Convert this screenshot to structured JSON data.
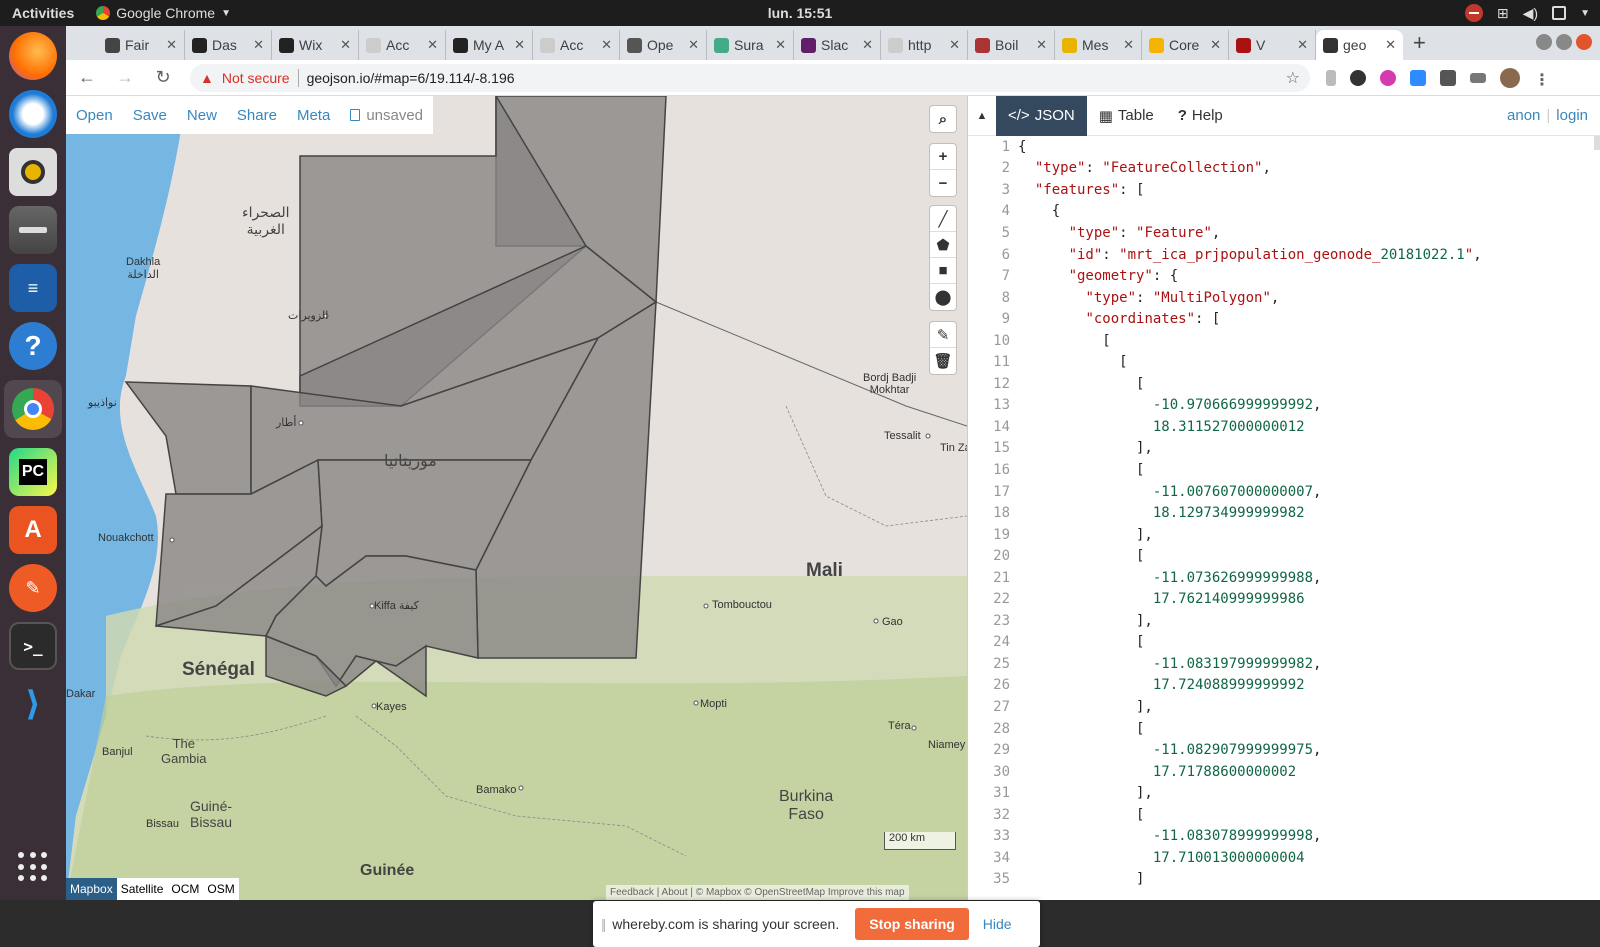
{
  "topbar": {
    "activities": "Activities",
    "app_name": "Google Chrome",
    "clock": "lun. 15:51"
  },
  "dock": {
    "apps": [
      "Firefox",
      "Thunderbird",
      "Rhythmbox",
      "Files",
      "LibreOffice Writer",
      "Help",
      "Google Chrome",
      "PyCharm",
      "Ubuntu Software",
      "Postman",
      "Terminal",
      "Visual Studio Code"
    ]
  },
  "browser": {
    "tabs": [
      {
        "label": "Fair",
        "color": "#444"
      },
      {
        "label": "Das",
        "color": "#222"
      },
      {
        "label": "Wix",
        "color": "#222"
      },
      {
        "label": "Acc",
        "color": "#ccc"
      },
      {
        "label": "My A",
        "color": "#222"
      },
      {
        "label": "Acc",
        "color": "#ccc"
      },
      {
        "label": "Ope",
        "color": "#555"
      },
      {
        "label": "Sura",
        "color": "#4a8"
      },
      {
        "label": "Slac",
        "color": "#611f69"
      },
      {
        "label": "http",
        "color": "#ccc"
      },
      {
        "label": "Boil",
        "color": "#a33"
      },
      {
        "label": "Mes",
        "color": "#e8b400"
      },
      {
        "label": "Core",
        "color": "#f4b400"
      },
      {
        "label": "V",
        "color": "#a11"
      },
      {
        "label": "geo",
        "color": "#333",
        "active": true
      }
    ],
    "security": "Not secure",
    "url": "geojson.io/#map=6/19.114/-8.196"
  },
  "geojson": {
    "menu": {
      "open": "Open",
      "save": "Save",
      "new": "New",
      "share": "Share",
      "meta": "Meta",
      "status": "unsaved"
    },
    "tabs": {
      "json": "JSON",
      "table": "Table",
      "help": "Help"
    },
    "auth": {
      "anon": "anon",
      "separator": "|",
      "login": "login"
    },
    "map": {
      "labels": {
        "western_sahara": "الصحراء\nالغربية",
        "dakhla": "Dakhla\nالداخلة",
        "zouerat": "الزويرات",
        "nouadhibou": "نواذيبو",
        "atar": "أطار",
        "mauritania": "موريتانيا",
        "nouakchott": "Nouakchott",
        "kiffa": "Kiffa كيفة",
        "senegal": "Sénégal",
        "dakar": "Dakar",
        "banjul": "Banjul",
        "the_gambia": "The\nGambia",
        "guinea_bissau": "Guiné-\nBissau",
        "bissau": "Bissau",
        "guinee": "Guinée",
        "kayes": "Kayes",
        "bamako": "Bamako",
        "mali": "Mali",
        "tombouctou": "Tombouctou",
        "gao": "Gao",
        "mopti": "Mopti",
        "burkina_faso": "Burkina\nFaso",
        "tera": "Téra",
        "niamey": "Niamey",
        "bordj": "Bordj Badji\nMokhtar",
        "tessalit": "Tessalit",
        "tin_zaouaten": "Tin Za"
      },
      "layers": [
        "Mapbox",
        "Satellite",
        "OCM",
        "OSM"
      ],
      "active_layer": "Mapbox",
      "scale": "200 km",
      "attribution": "Feedback | About | © Mapbox © OpenStreetMap Improve this map"
    },
    "share_notice": {
      "text": "whereby.com is sharing your screen.",
      "stop": "Stop sharing",
      "hide": "Hide"
    },
    "code_lines": [
      "{",
      "  \"type\": \"FeatureCollection\",",
      "  \"features\": [",
      "    {",
      "      \"type\": \"Feature\",",
      "      \"id\": \"mrt_ica_prjpopulation_geonode_20181022.1\",",
      "      \"geometry\": {",
      "        \"type\": \"MultiPolygon\",",
      "        \"coordinates\": [",
      "          [",
      "            [",
      "              [",
      "                -10.970666999999992,",
      "                18.311527000000012",
      "              ],",
      "              [",
      "                -11.007607000000007,",
      "                18.129734999999982",
      "              ],",
      "              [",
      "                -11.073626999999988,",
      "                17.762140999999986",
      "              ],",
      "              [",
      "                -11.083197999999982,",
      "                17.724088999999992",
      "              ],",
      "              [",
      "                -11.082907999999975,",
      "                17.71788600000002",
      "              ],",
      "              [",
      "                -11.083078999999998,",
      "                17.710013000000004",
      "              ]"
    ]
  }
}
